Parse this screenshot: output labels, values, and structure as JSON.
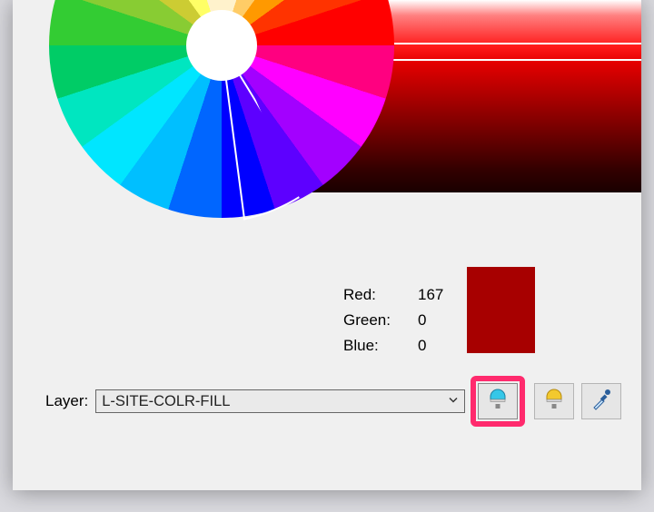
{
  "picker": {
    "selected_hue_deg": 66,
    "selected_value_index": 3
  },
  "rgb": {
    "red": {
      "label": "Red:",
      "value": 167
    },
    "green": {
      "label": "Green:",
      "value": 0
    },
    "blue": {
      "label": "Blue:",
      "value": 0
    }
  },
  "swatch_hex": "#a70000",
  "layer": {
    "label": "Layer:",
    "value": "L-SITE-COLR-FILL"
  },
  "buttons": {
    "cool": "cool-marker-icon",
    "warm": "warm-marker-icon",
    "eyedrop": "eyedropper-icon"
  },
  "value_strip_colors": [
    "#ffffff",
    "#ff8080",
    "#ff4d4d",
    "#ff1a1a",
    "#e60000",
    "#cc0000",
    "#b30000",
    "#990000",
    "#800000",
    "#660000",
    "#4d0000",
    "#330000",
    "#1a0000"
  ]
}
